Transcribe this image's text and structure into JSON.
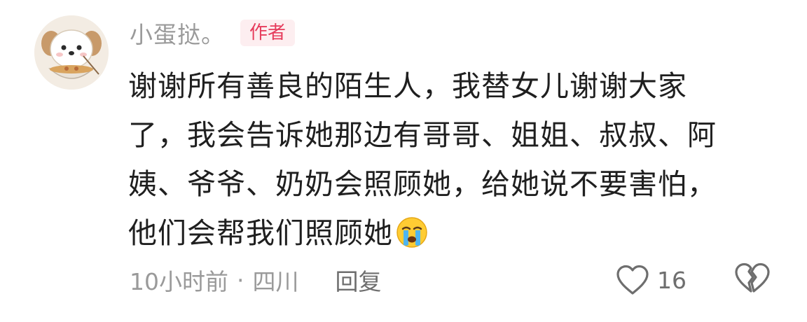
{
  "comment": {
    "avatar_icon": "puppy-eating-noodles-avatar",
    "username": "小蛋挞。",
    "author_badge": "作者",
    "lines": [
      "谢谢所有善良的陌生人，我替女儿谢谢大家",
      "了，我会告诉她那边有哥哥、姐姐、叔叔、阿",
      "姨、爷爷、奶奶会照顾她，给她说不要害怕，",
      "他们会帮我们照顾她"
    ],
    "emoji": "crying-face-emoji",
    "time": "10小时前",
    "separator": "·",
    "location": "四川",
    "reply_label": "回复",
    "like_icon": "heart-outline-icon",
    "like_count": "16",
    "dislike_icon": "broken-heart-icon"
  },
  "colors": {
    "badge_text": "#e63c5c",
    "badge_bg": "#fdeef0",
    "meta_text": "#9a9a9a"
  }
}
